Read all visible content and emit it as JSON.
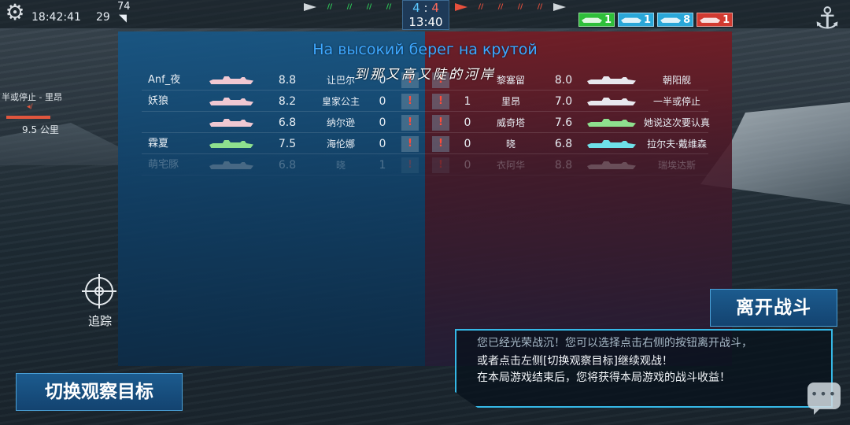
{
  "topbar": {
    "clock": "18:42:41",
    "ping": "29",
    "fps": "74",
    "score_blue": "4",
    "score_sep": ":",
    "score_red": "4",
    "timer": "13:40",
    "ship_counts": [
      {
        "count": "1",
        "color": "#2fbf3a"
      },
      {
        "count": "1",
        "color": "#2aa7d8"
      },
      {
        "count": "8",
        "color": "#2aa7d8"
      },
      {
        "count": "1",
        "color": "#d23a30"
      }
    ]
  },
  "hud": {
    "status": "半或停止 - 里昂",
    "distance": "9.5 公里",
    "track_label": "追踪"
  },
  "lyrics": {
    "line1": "На высокий берег на крутой",
    "line2": "到那又高又陡的河岸"
  },
  "scoreboard": {
    "rows": [
      {
        "left_name": "Anf_夜",
        "left_rank": "8.8",
        "left_ship": "让巴尔",
        "left_kills": "0",
        "right_kills": "",
        "right_ship": "黎塞留",
        "right_rank": "8.0",
        "right_name": "朝阳舰",
        "left_sil_color": "#f0c8d2",
        "right_sil_color": "#e8e8ee",
        "dim": false
      },
      {
        "left_name": "妖狼",
        "left_rank": "8.2",
        "left_ship": "皇家公主",
        "left_kills": "0",
        "right_kills": "1",
        "right_ship": "里昂",
        "right_rank": "7.0",
        "right_name": "一半或停止",
        "left_sil_color": "#f0c8d2",
        "right_sil_color": "#e8e8ee",
        "dim": false
      },
      {
        "left_name": "",
        "left_rank": "6.8",
        "left_ship": "纳尔逊",
        "left_kills": "0",
        "right_kills": "0",
        "right_ship": "威奇塔",
        "right_rank": "7.6",
        "right_name": "她说这次要认真",
        "left_sil_color": "#f0c8d2",
        "right_sil_color": "#8ee08e",
        "dim": false
      },
      {
        "left_name": "霖夏",
        "left_rank": "7.5",
        "left_ship": "海伦娜",
        "left_kills": "0",
        "right_kills": "0",
        "right_ship": "晓",
        "right_rank": "6.8",
        "right_name": "拉尔夫·戴维森",
        "left_sil_color": "#8ee08e",
        "right_sil_color": "#6ee0e8",
        "dim": false
      },
      {
        "left_name": "萌宅豚",
        "left_rank": "6.8",
        "left_ship": "晓",
        "left_kills": "1",
        "right_kills": "0",
        "right_ship": "衣阿华",
        "right_rank": "8.8",
        "right_name": "瑞埃达斯",
        "left_sil_color": "#cfcfcf",
        "right_sil_color": "#cfcfcf",
        "dim": true
      }
    ],
    "report_glyph": "!"
  },
  "actions": {
    "leave_battle": "离开战斗",
    "switch_target": "切换观察目标",
    "message_line1": "您已经光荣战沉！您可以选择点击右侧的按钮离开战斗，",
    "message_line2": "或者点击左侧[切换观察目标]继续观战！",
    "message_line3": "在本局游戏结束后，您将获得本局游戏的战斗收益！"
  },
  "icons": {
    "settings": "gear-icon",
    "wifi": "wifi-icon",
    "anchor": "anchor-icon",
    "crosshair": "crosshair-icon",
    "chat": "chat-icon"
  }
}
